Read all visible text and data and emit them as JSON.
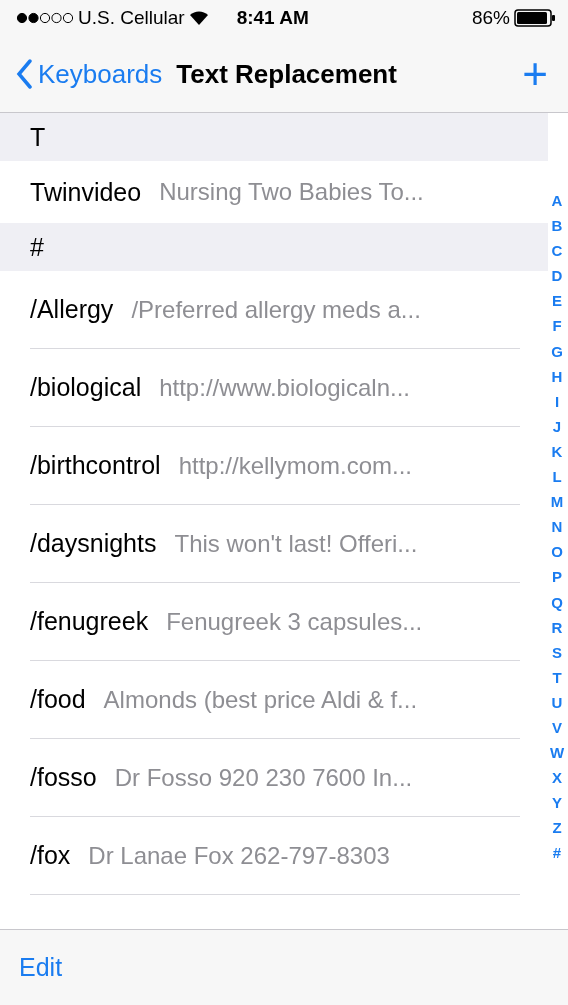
{
  "status_bar": {
    "carrier": "U.S. Cellular",
    "time": "8:41 AM",
    "battery": "86%"
  },
  "nav": {
    "back": "Keyboards",
    "title": "Text Replacement",
    "add": "+"
  },
  "sections": [
    {
      "header": "T",
      "rows": [
        {
          "phrase": "Twinvideo",
          "text": "Nursing Two Babies To..."
        }
      ]
    },
    {
      "header": "#",
      "rows": [
        {
          "phrase": "/Allergy",
          "text": "/Preferred allergy meds a..."
        },
        {
          "phrase": "/biological",
          "text": "http://www.biologicaln..."
        },
        {
          "phrase": "/birthcontrol",
          "text": "http://kellymom.com..."
        },
        {
          "phrase": "/daysnights",
          "text": "This won't last! Offeri..."
        },
        {
          "phrase": "/fenugreek",
          "text": "Fenugreek 3 capsules..."
        },
        {
          "phrase": "/food",
          "text": "Almonds (best price Aldi & f..."
        },
        {
          "phrase": "/fosso",
          "text": "Dr Fosso 920 230 7600 In..."
        },
        {
          "phrase": "/fox",
          "text": "Dr Lanae Fox 262-797-8303"
        }
      ]
    }
  ],
  "index": [
    "A",
    "B",
    "C",
    "D",
    "E",
    "F",
    "G",
    "H",
    "I",
    "J",
    "K",
    "L",
    "M",
    "N",
    "O",
    "P",
    "Q",
    "R",
    "S",
    "T",
    "U",
    "V",
    "W",
    "X",
    "Y",
    "Z",
    "#"
  ],
  "toolbar": {
    "edit": "Edit"
  }
}
